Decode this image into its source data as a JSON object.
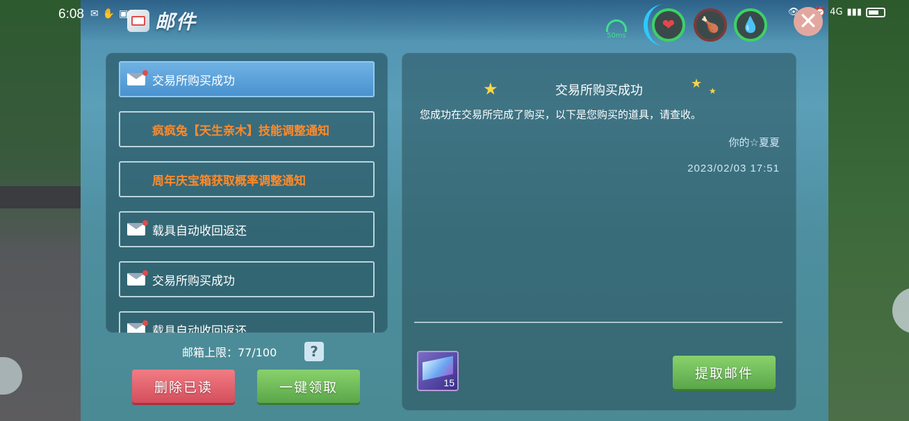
{
  "status_bar": {
    "time": "6:08",
    "network": "4G"
  },
  "header": {
    "title": "邮件",
    "ping": "50ms"
  },
  "mail_list": {
    "items": [
      {
        "label": "交易所购买成功",
        "type": "mail",
        "active": true
      },
      {
        "label": "疯疯兔【天生亲木】技能调整通知",
        "type": "notice",
        "active": false
      },
      {
        "label": "周年庆宝箱获取概率调整通知",
        "type": "notice",
        "active": false
      },
      {
        "label": "载具自动收回返还",
        "type": "mail",
        "active": false
      },
      {
        "label": "交易所购买成功",
        "type": "mail",
        "active": false
      },
      {
        "label": "载具自动收回返还",
        "type": "mail",
        "active": false
      }
    ],
    "quota": "邮箱上限：77/100",
    "help_label": "?"
  },
  "actions": {
    "delete_read": "删除已读",
    "claim_all": "一键领取",
    "claim_mail": "提取邮件"
  },
  "detail": {
    "title": "交易所购买成功",
    "body": "您成功在交易所完成了购买，以下是您购买的道具，请查收。",
    "signature": "你的☆夏夏",
    "date": "2023/02/03 17:51",
    "attachment": {
      "count": "15"
    }
  },
  "icons": {
    "heart": "heart-icon",
    "food": "food-icon",
    "water": "water-drop-icon",
    "close": "close-icon",
    "envelope": "envelope-icon"
  },
  "colors": {
    "accent_blue": "#4a92cf",
    "notice_orange": "#ff8a2a",
    "delete_red": "#d44e5c",
    "confirm_green": "#5aa74a"
  }
}
